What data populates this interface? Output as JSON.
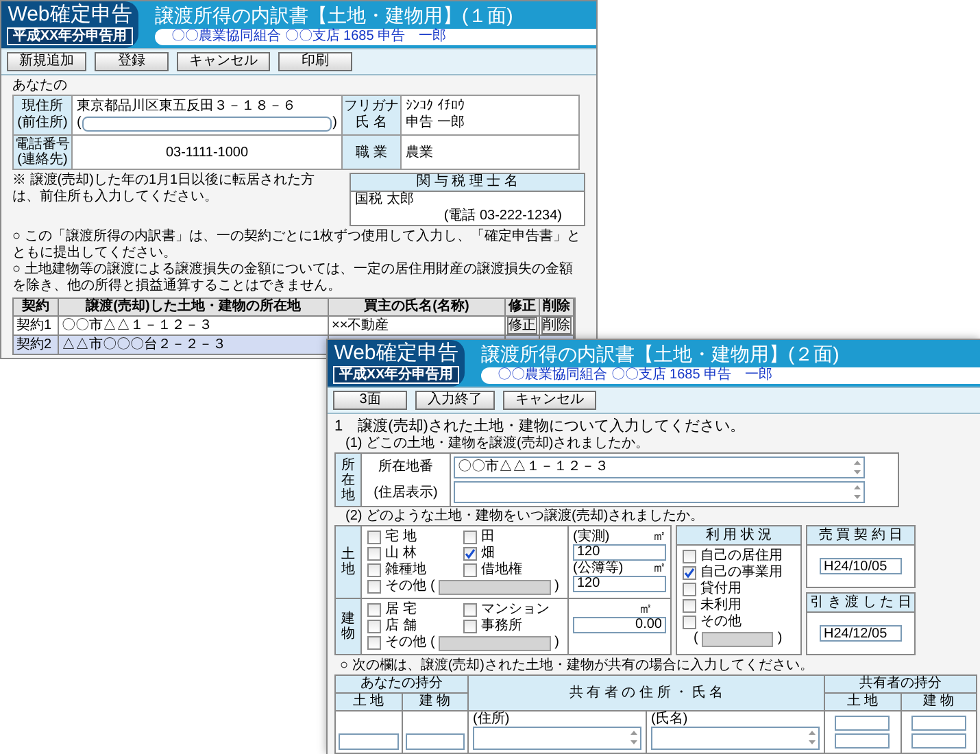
{
  "back_window": {
    "logo": "Web確定申告",
    "edition": "平成XX年分申告用",
    "title": "譲渡所得の内訳書【土地・建物用】(１面)",
    "subtitle": "〇〇農業協同組合 〇〇支店 1685 申告　一郎",
    "toolbar": [
      "新規追加",
      "登録",
      "キャンセル",
      "印刷"
    ],
    "taxpayer": {
      "heading": "あなたの",
      "address_labels": [
        "現住所",
        "(前住所)"
      ],
      "address": "東京都品川区東五反田３－１８－６",
      "prev_address_brackets": [
        "(",
        ")"
      ],
      "name_labels": [
        "フリガナ",
        "氏 名"
      ],
      "name_values": [
        "ｼﾝｺｸ ｲﾁﾛｳ",
        "申告 一郎"
      ],
      "phone_labels": [
        "電話番号",
        "(連絡先)"
      ],
      "phone": "03-1111-1000",
      "occupation_label": "職 業",
      "occupation": "農業"
    },
    "note": "※ 譲渡(売却)した年の1月1日以後に転居された方は、前住所も入力してください。",
    "tax_accountant": {
      "header": "関 与 税 理 士 名",
      "name": "国税 太郎",
      "phone": "(電話 03-222-1234)"
    },
    "notices": [
      "○ この「譲渡所得の内訳書」は、一の契約ごとに1枚ずつ使用して入力し、「確定申告書」とともに提出してください。",
      "○ 土地建物等の譲渡による譲渡損失の金額については、一定の居住用財産の譲渡損失の金額を除き、他の所得と損益通算することはできません。"
    ],
    "contracts": {
      "columns": [
        "契約",
        "譲渡(売却)した土地・建物の所在地",
        "買主の氏名(名称)",
        "修正",
        "削除"
      ],
      "rows": [
        {
          "label": "契約1",
          "location": "〇〇市△△１－１２－３",
          "buyer": "××不動産",
          "actions": [
            "修正",
            "削除"
          ],
          "selected": false
        },
        {
          "label": "契約2",
          "location": "△△市〇〇〇台２－２－３",
          "selected": true
        }
      ]
    }
  },
  "front_window": {
    "logo": "Web確定申告",
    "edition": "平成XX年分申告用",
    "title": "譲渡所得の内訳書【土地・建物用】(２面)",
    "subtitle": "〇〇農業協同組合 〇〇支店 1685 申告　一郎",
    "toolbar": [
      "3面",
      "入力終了",
      "キャンセル"
    ],
    "heading": "1　譲渡(売却)された土地・建物について入力してください。",
    "q1": "(1) どこの土地・建物を譲渡(売却)されましたか。",
    "location": {
      "label": "所在地",
      "rows": [
        {
          "label": "所在地番",
          "value": "〇〇市△△１－１２－３"
        },
        {
          "label": "(住居表示)"
        }
      ]
    },
    "q2": "(2) どのような土地・建物をいつ譲渡(売却)されましたか。",
    "land": {
      "label": "土地",
      "types": [
        {
          "label": "宅 地",
          "checked": false
        },
        {
          "label": "田",
          "checked": false
        },
        {
          "label": "山 林",
          "checked": false
        },
        {
          "label": "畑",
          "checked": true
        },
        {
          "label": "雑種地",
          "checked": false
        },
        {
          "label": "借地権",
          "checked": false
        }
      ],
      "other": {
        "label": "その他",
        "open": "(",
        "close": ")",
        "checked": false,
        "input_disabled": true
      },
      "areas": [
        {
          "label": "(実測)",
          "unit": "㎡",
          "value": "120"
        },
        {
          "label": "(公簿等)",
          "unit": "㎡",
          "value": "120"
        }
      ]
    },
    "building": {
      "label": "建物",
      "types": [
        {
          "label": "居 宅",
          "checked": false
        },
        {
          "label": "マンション",
          "checked": false
        },
        {
          "label": "店 舗",
          "checked": false
        },
        {
          "label": "事務所",
          "checked": false
        }
      ],
      "other": {
        "label": "その他",
        "open": "(",
        "close": ")",
        "checked": false,
        "input_disabled": true
      },
      "area": {
        "unit": "㎡",
        "value": "0.00"
      }
    },
    "usage": {
      "header": "利 用 状 況",
      "options": [
        {
          "label": "自己の居住用",
          "checked": false
        },
        {
          "label": "自己の事業用",
          "checked": true
        },
        {
          "label": "貸付用",
          "checked": false
        },
        {
          "label": "未利用",
          "checked": false
        },
        {
          "label": "その他",
          "checked": false
        }
      ],
      "other_open": "(",
      "other_close": ")",
      "input_disabled": true
    },
    "dates": [
      {
        "header": "売 買 契 約 日",
        "value": "H24/10/05"
      },
      {
        "header": "引 き 渡 し た 日",
        "value": "H24/12/05"
      }
    ],
    "co_owner_note": "○ 次の欄は、譲渡(売却)された土地・建物が共有の場合に入力してください。",
    "co_owner": {
      "your_share": {
        "header": "あなたの持分",
        "columns": [
          "土 地",
          "建 物"
        ]
      },
      "co_owners": {
        "header": "共 有 者 の 住 所 ・ 氏 名",
        "fields": [
          "(住所)",
          "(氏名)"
        ]
      },
      "co_owner_share": {
        "header": "共有者の持分",
        "columns": [
          "土 地",
          "建 物"
        ]
      }
    }
  }
}
